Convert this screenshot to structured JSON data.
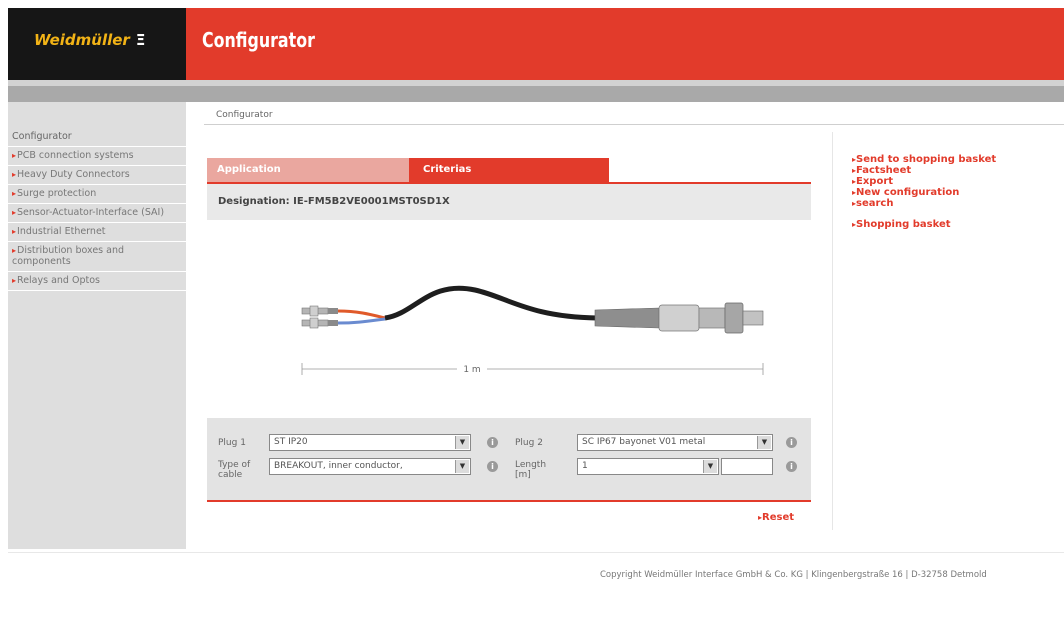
{
  "header": {
    "logo_text": "Weidmüller",
    "logo_mark": "Ξ",
    "title": "Configurator"
  },
  "breadcrumb": "Configurator",
  "sidebar": {
    "title": "Configurator",
    "items": [
      {
        "label": "PCB connection systems"
      },
      {
        "label": "Heavy Duty Connectors"
      },
      {
        "label": "Surge protection"
      },
      {
        "label": "Sensor-Actuator-Interface (SAI)"
      },
      {
        "label": "Industrial Ethernet"
      },
      {
        "label": "Distribution boxes and components"
      },
      {
        "label": "Relays and Optos"
      }
    ]
  },
  "tabs": [
    {
      "label": "Application"
    },
    {
      "label": "Criterias"
    }
  ],
  "designation": "Designation: IE-FM5B2VE0001MST0SD1X",
  "product": {
    "length_label": "1 m"
  },
  "config": {
    "plug1_label": "Plug 1",
    "plug1_value": "ST IP20",
    "cable_label": "Type of cable",
    "cable_value": "BREAKOUT, inner conductor,",
    "plug2_label": "Plug 2",
    "plug2_value": "SC IP67 bayonet V01 metal",
    "length_label": "Length [m]",
    "length_value": "1",
    "length_extra_value": ""
  },
  "reset_label": "Reset",
  "right_links": {
    "send": "Send to shopping basket",
    "factsheet": "Factsheet",
    "export": "Export",
    "new_config": "New configuration",
    "search": "search",
    "basket": "Shopping basket"
  },
  "footer": {
    "copyright": "Copyright Weidmüller Interface GmbH & Co. KG | Klingenbergstraße 16 | D-32758 Detmold"
  },
  "colors": {
    "brand_red": "#e23b2b",
    "logo_yellow": "#f2b316",
    "logo_bg": "#161616",
    "sidebar_bg": "#dedede"
  },
  "icons": {
    "arrow": "arrow-right-icon",
    "info": "info-icon",
    "dropdown": "chevron-down-icon"
  }
}
